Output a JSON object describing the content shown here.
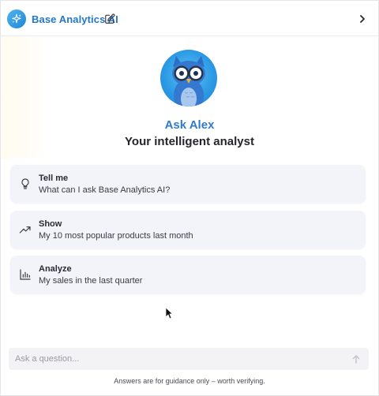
{
  "header": {
    "app_title": "Base Analytics AI",
    "logo_icon": "sparkle-icon",
    "edit_icon": "edit-icon",
    "collapse_icon": "chevron-right-icon",
    "brand_color": "#2477c6"
  },
  "assistant": {
    "name": "Ask Alex",
    "tagline": "Your intelligent analyst",
    "avatar_icon": "owl-avatar"
  },
  "suggestions": [
    {
      "icon": "lightbulb-icon",
      "title": "Tell me",
      "text": "What can I ask Base Analytics AI?"
    },
    {
      "icon": "trending-up-icon",
      "title": "Show",
      "text": "My 10 most popular products last month"
    },
    {
      "icon": "bar-chart-icon",
      "title": "Analyze",
      "text": "My sales in the last quarter"
    }
  ],
  "composer": {
    "placeholder": "Ask a question...",
    "value": "",
    "send_icon": "arrow-up-icon"
  },
  "footer": {
    "disclaimer": "Answers are for guidance only – worth verifying."
  }
}
